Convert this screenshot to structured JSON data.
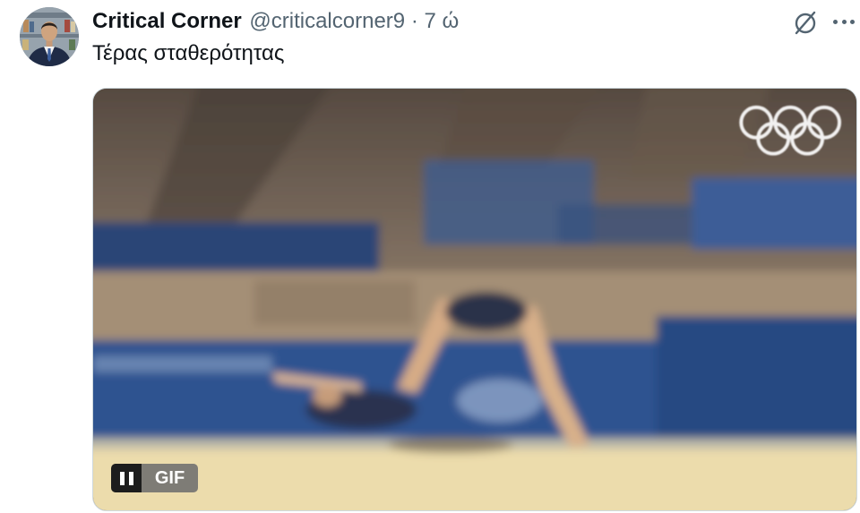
{
  "tweet": {
    "author_name": "Critical Corner",
    "handle": "@criticalcorner9",
    "separator": "·",
    "time": "7 ώ",
    "text": "Τέρας σταθερότητας"
  },
  "media": {
    "type": "gif",
    "badge_label": "GIF"
  },
  "icons": {
    "grok": "grok-icon",
    "more": "more-icon",
    "pause": "pause-icon"
  },
  "colors": {
    "text": "#0f1419",
    "secondary_text": "#536471",
    "border": "#cfd9de"
  }
}
